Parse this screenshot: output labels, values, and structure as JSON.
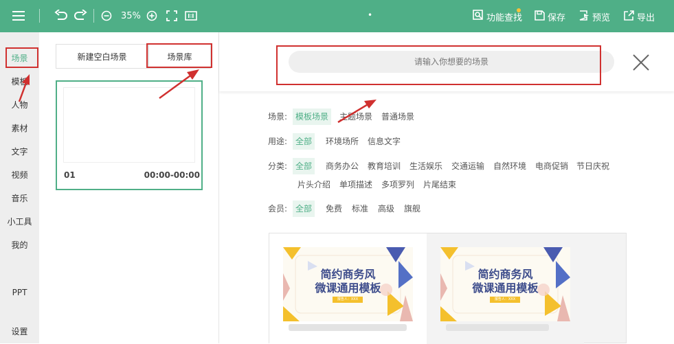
{
  "toolbar": {
    "zoom": "35%",
    "feature_search": "功能查找",
    "save": "保存",
    "preview": "预览",
    "export": "导出",
    "center_mark": "•"
  },
  "sidebar": {
    "items": [
      {
        "label": "场景"
      },
      {
        "label": "模板"
      },
      {
        "label": "人物"
      },
      {
        "label": "素材"
      },
      {
        "label": "文字"
      },
      {
        "label": "视频"
      },
      {
        "label": "音乐"
      },
      {
        "label": "小工具"
      },
      {
        "label": "我的"
      },
      {
        "label": "PPT"
      },
      {
        "label": "设置"
      }
    ]
  },
  "scene_panel": {
    "tabs": [
      {
        "label": "新建空白场景"
      },
      {
        "label": "场景库"
      }
    ],
    "card": {
      "index": "01",
      "time": "00:00-00:00"
    }
  },
  "search": {
    "placeholder": "请输入你想要的场景"
  },
  "filters": {
    "scene": {
      "label": "场景:",
      "options": [
        "模板场景",
        "主题场景",
        "普通场景"
      ],
      "selected": "模板场景"
    },
    "usage": {
      "label": "用途:",
      "options": [
        "全部",
        "环境场所",
        "信息文字"
      ],
      "selected": "全部"
    },
    "category": {
      "label": "分类:",
      "options": [
        "全部",
        "商务办公",
        "教育培训",
        "生活娱乐",
        "交通运输",
        "自然环境",
        "电商促销",
        "节日庆祝",
        "片头介绍",
        "单项描述",
        "多项罗列",
        "片尾结束"
      ],
      "selected": "全部"
    },
    "member": {
      "label": "会员:",
      "options": [
        "全部",
        "免费",
        "标准",
        "高级",
        "旗舰"
      ],
      "selected": "全部"
    }
  },
  "templates": [
    {
      "title_line1": "简约商务风",
      "title_line2": "微课通用模板",
      "tag": "报告人：XXX"
    },
    {
      "title_line1": "简约商务风",
      "title_line2": "微课通用模板",
      "tag": "报告人：XXX"
    }
  ],
  "colors": {
    "accent": "#4faf87",
    "annotation": "#d0302f",
    "template_yellow": "#f4c02d",
    "template_blue": "#3e4d8c"
  }
}
